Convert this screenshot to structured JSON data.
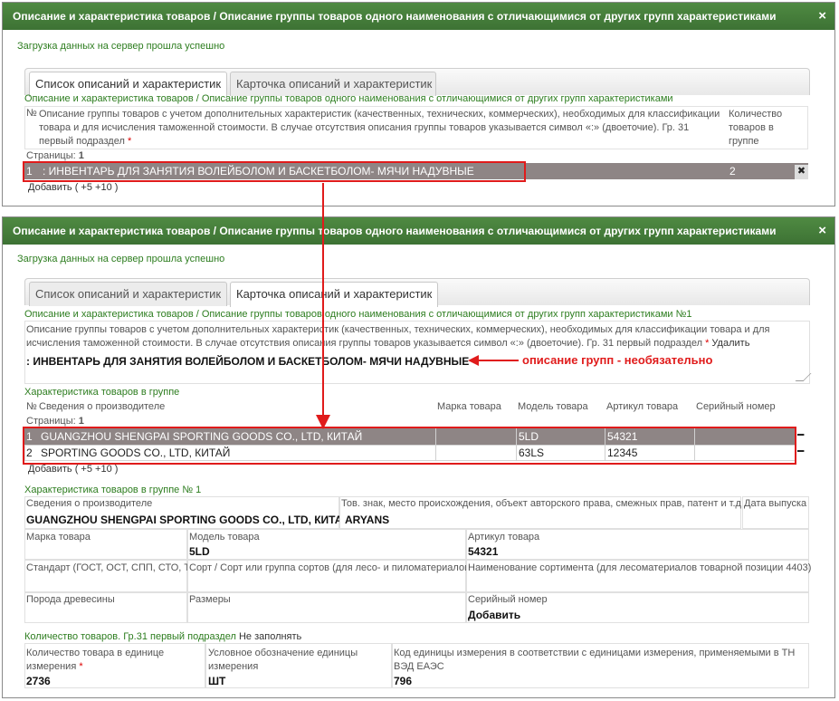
{
  "colors": {
    "titlebar": "#3d7234",
    "success": "#2d7d1f",
    "annotation_red": "#e01b1b",
    "selected_row": "#8e8585"
  },
  "panel1": {
    "title": "Описание и характеристика товаров / Описание группы товаров одного наименования с отличающимися от других групп характеристиками",
    "close": "×",
    "success": "Загрузка данных на сервер прошла успешно",
    "tabs": [
      "Список описаний и характеристик",
      "Карточка описаний и характеристик"
    ],
    "breadcrumb": "Описание и характеристика товаров / Описание группы товаров одного наименования с отличающимися от других групп характеристиками",
    "headers": {
      "num": "№",
      "desc": "Описание группы товаров с учетом дополнительных характеристик (качественных, технических, коммерческих), необходимых для классификации товара и для исчисления таможенной стоимости. В случае отсутствия описания группы товаров указывается символ «:» (двоеточие). Гр. 31 первый подраздел",
      "req": "*",
      "count": "Количество товаров в группе"
    },
    "pages_label": "Страницы:",
    "pages_value": "1",
    "row": {
      "num": "1",
      "desc": ": ИНВЕНТАРЬ ДЛЯ ЗАНЯТИЯ ВОЛЕЙБОЛОМ И БАСКЕТБОЛОМ- МЯЧИ НАДУВНЫЕ",
      "count": "2",
      "delete": "✖"
    },
    "add": "Добавить",
    "add5": "+5",
    "add10": "+10"
  },
  "panel2": {
    "title": "Описание и характеристика товаров / Описание группы товаров одного наименования с отличающимися от других групп характеристиками",
    "close": "×",
    "success": "Загрузка данных на сервер прошла успешно",
    "tabs": [
      "Список описаний и характеристик",
      "Карточка описаний и характеристик"
    ],
    "breadcrumb": "Описание и характеристика товаров / Описание группы товаров одного наименования с отличающимися от других групп характеристиками №1",
    "desc_label": "Описание группы товаров с учетом дополнительных характеристик (качественных, технических, коммерческих), необходимых для классификации товара и для исчисления таможенной стоимости. В случае отсутствия описания группы товаров указывается символ «:» (двоеточие). Гр. 31 первый подраздел",
    "req": "*",
    "delete": "Удалить",
    "desc_value": ": ИНВЕНТАРЬ ДЛЯ ЗАНЯТИЯ ВОЛЕЙБОЛОМ И БАСКЕТБОЛОМ- МЯЧИ НАДУВНЫЕ",
    "annotation": "описание групп  - необязательно",
    "chars_title": "Характеристика товаров в группе",
    "table_headers": {
      "num": "№",
      "maker": "Сведения о производителе",
      "brand": "Марка товара",
      "model": "Модель товара",
      "article": "Артикул товара",
      "serial": "Серийный номер"
    },
    "pages_label": "Страницы:",
    "pages_value": "1",
    "rows": [
      {
        "num": "1",
        "maker": "GUANGZHOU SHENGPAI SPORTING GOODS CO., LTD, КИТАЙ",
        "brand": "",
        "model": "5LD",
        "article": "54321",
        "serial": "",
        "remove": "━"
      },
      {
        "num": "2",
        "maker": "SPORTING GOODS CO., LTD, КИТАЙ",
        "brand": "",
        "model": "63LS",
        "article": "12345",
        "serial": "",
        "remove": "━"
      }
    ],
    "add": "Добавить",
    "add5": "+5",
    "add10": "+10",
    "detail_title": "Характеристика товаров в группе № 1",
    "detail": {
      "maker_label": "Сведения о производителе",
      "maker_value": "GUANGZHOU SHENGPAI SPORTING GOODS CO., LTD, КИТАЙ",
      "tm_label": "Тов. знак, место происхождения, объект авторского права, смежных прав, патент и т.д.",
      "tm_value": "ARYANS",
      "date_label": "Дата выпуска",
      "brand_label": "Марка товара",
      "model_label": "Модель товара",
      "model_value": "5LD",
      "article_label": "Артикул товара",
      "article_value": "54321",
      "standard_label": "Стандарт (ГОСТ, ОСТ, СПП, СТО, ТУ)",
      "sort_label": "Сорт / Сорт или группа сортов (для лесо- и пиломатериалов)",
      "assort_label": "Наименование сортимента (для лесоматериалов товарной позиции 4403)",
      "wood_label": "Порода древесины",
      "size_label": "Размеры",
      "serial_label": "Серийный номер",
      "serial_add": "Добавить"
    },
    "qty_title": "Количество товаров. Гр.31 первый подраздел",
    "qty_note": "Не заполнять",
    "qty": {
      "amount_label": "Количество товара в единице измерения",
      "amount_value": "2736",
      "unit_label": "Условное обозначение единицы измерения",
      "unit_value": "ШТ",
      "code_label": "Код единицы измерения в соответствии с единицами измерения, применяемыми в ТН ВЭД ЕАЭС",
      "code_value": "796"
    }
  }
}
